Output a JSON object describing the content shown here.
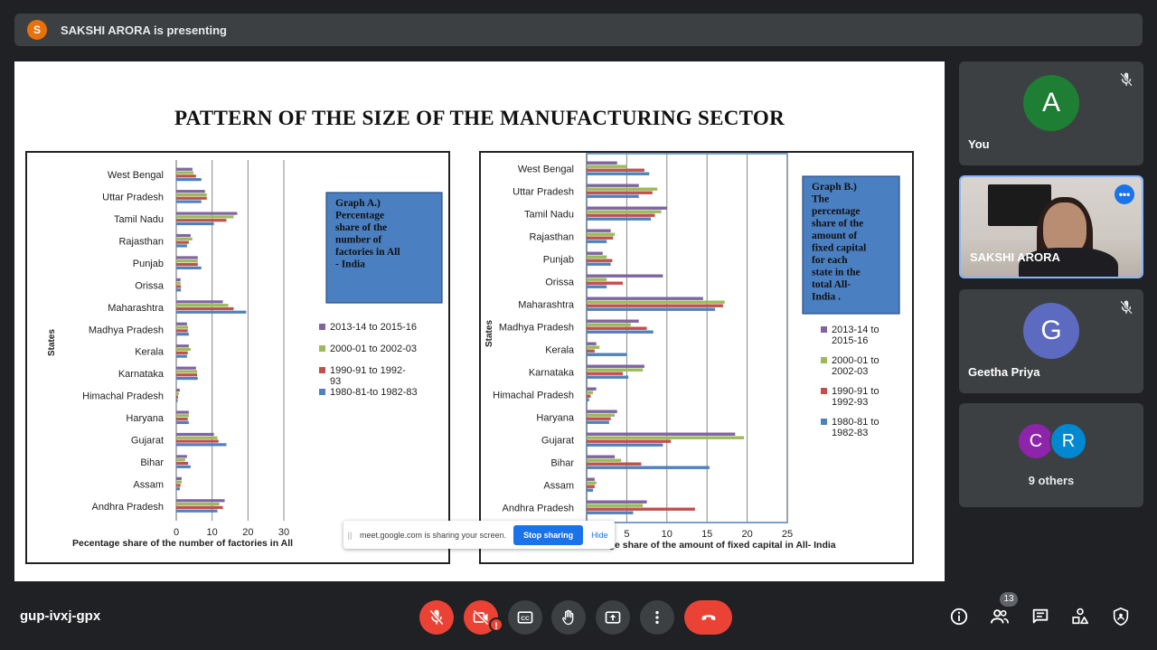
{
  "topbar": {
    "avatar_letter": "S",
    "presenting_text": "SAKSHI ARORA is presenting"
  },
  "slide": {
    "title": "PATTERN OF THE SIZE OF THE MANUFACTURING SECTOR"
  },
  "chart_data": [
    {
      "type": "bar",
      "orientation": "horizontal",
      "ylabel": "States",
      "xlabel": "Pecentage share of the number of factories in All",
      "annotation": "Graph A.) Percentage share of the number of factories in All - India",
      "xlim": [
        0,
        30
      ],
      "xticks": [
        "0",
        "10",
        "20",
        "30"
      ],
      "grid": true,
      "legend_position": "right",
      "categories": [
        "West Bengal",
        "Uttar Pradesh",
        "Tamil Nadu",
        "Rajasthan",
        "Punjab",
        "Orissa",
        "Maharashtra",
        "Madhya Pradesh",
        "Kerala",
        "Karnataka",
        "Himachal Pradesh",
        "Haryana",
        "Gujarat",
        "Bihar",
        "Assam",
        "Andhra Pradesh"
      ],
      "series": [
        {
          "name": "2013-14 to 2015-16",
          "color": "#8064a2",
          "values": [
            4.5,
            8,
            17,
            4,
            6,
            1.2,
            13,
            3,
            3.5,
            5.5,
            1,
            3.5,
            10.5,
            3,
            1.5,
            13.5
          ]
        },
        {
          "name": "2000-01 to 2002-03",
          "color": "#9bbb59",
          "values": [
            4.8,
            8.5,
            16,
            4.5,
            6,
            1.2,
            14.5,
            3.3,
            4,
            5.8,
            0.7,
            3.5,
            11.5,
            2.5,
            1.5,
            12
          ]
        },
        {
          "name": "1990-91 to 1992-93",
          "color": "#c0504d",
          "values": [
            5.5,
            8.5,
            14,
            3.5,
            6,
            1.3,
            16,
            3.2,
            3.2,
            5.8,
            0.5,
            3.2,
            11.8,
            3.3,
            1.2,
            13
          ]
        },
        {
          "name": "1980-81-to 1982-83",
          "color": "#4f81bd",
          "values": [
            7,
            7,
            10.5,
            3,
            7,
            1.3,
            19.5,
            3.5,
            3,
            6,
            0.4,
            3.5,
            14,
            4,
            1,
            11.5
          ]
        }
      ],
      "legend_labels": [
        "2013-14 to 2015-16",
        "2000-01 to 2002-03",
        "1990-91 to 1992-93",
        "1980-81-to 1982-83"
      ]
    },
    {
      "type": "bar",
      "orientation": "horizontal",
      "ylabel": "States",
      "xlabel": "Pecentage share of the amount of fixed capital in All- India",
      "xlabel_visible": "entage share of the amount of fixed capital in All- India",
      "annotation": "Graph B.) The percentage share of the amount of fixed capital for each state in the total All- India .",
      "xlim": [
        0,
        25
      ],
      "xticks": [
        "5",
        "10",
        "15",
        "20",
        "25"
      ],
      "grid": true,
      "legend_position": "right",
      "categories": [
        "West Bengal",
        "Uttar Pradesh",
        "Tamil Nadu",
        "Rajasthan",
        "Punjab",
        "Orissa",
        "Maharashtra",
        "Madhya Pradesh",
        "Kerala",
        "Karnataka",
        "Himachal Pradesh",
        "Haryana",
        "Gujarat",
        "Bihar",
        "Assam",
        "Andhra Pradesh"
      ],
      "series": [
        {
          "name": "2013-14 to 2015-16",
          "color": "#8064a2",
          "values": [
            3.8,
            6.5,
            10,
            3,
            2,
            9.5,
            14.5,
            6.5,
            1.2,
            7.2,
            1.2,
            3.8,
            18.5,
            3.5,
            1,
            7.5
          ]
        },
        {
          "name": "2000-01 to 2002-03",
          "color": "#9bbb59",
          "values": [
            5,
            8.8,
            9.3,
            3.5,
            2.5,
            2.5,
            17.2,
            5.5,
            1.6,
            7,
            0.8,
            3.5,
            19.6,
            4.3,
            1.2,
            7
          ]
        },
        {
          "name": "1990-91 to 1992-93",
          "color": "#c0504d",
          "values": [
            7.2,
            8.2,
            8.5,
            3.3,
            3.2,
            4.5,
            17,
            7.5,
            1,
            4.5,
            0.5,
            3,
            10.5,
            6.8,
            1,
            13.5
          ]
        },
        {
          "name": "1980-81 to 1982-83",
          "color": "#4f81bd",
          "values": [
            7.8,
            6.5,
            8,
            2.5,
            3,
            2.5,
            16,
            8.3,
            5,
            5.2,
            0.3,
            2.8,
            9.5,
            15.3,
            0.8,
            5.8
          ]
        }
      ],
      "legend_labels": [
        "2013-14 to 2015-16",
        "2000-01 to 2002-03",
        "1990-91 to 1992-93",
        "1980-81 to 1982-83"
      ]
    }
  ],
  "share_toast": {
    "grip": "||",
    "message": "meet.google.com is sharing your screen.",
    "stop_label": "Stop sharing",
    "hide_label": "Hide"
  },
  "participants": {
    "you": {
      "letter": "A",
      "name": "You",
      "color": "#1e7e34"
    },
    "sakshi": {
      "name": "SAKSHI ARORA",
      "more_label": "•••"
    },
    "geetha": {
      "letter": "G",
      "name": "Geetha Priya",
      "color": "#5c6bc0"
    },
    "others": {
      "letters": [
        "C",
        "R"
      ],
      "colors": [
        "#8e24aa",
        "#0288d1"
      ],
      "label": "9 others"
    }
  },
  "bottombar": {
    "meeting_code": "gup-ivxj-gpx",
    "camera_warning": "!",
    "people_count": "13"
  },
  "icons": [
    "mic-off-icon",
    "camera-off-icon",
    "captions-icon",
    "raise-hand-icon",
    "present-icon",
    "more-options-icon",
    "end-call-icon",
    "info-icon",
    "people-icon",
    "chat-icon",
    "activities-icon",
    "host-controls-icon"
  ]
}
